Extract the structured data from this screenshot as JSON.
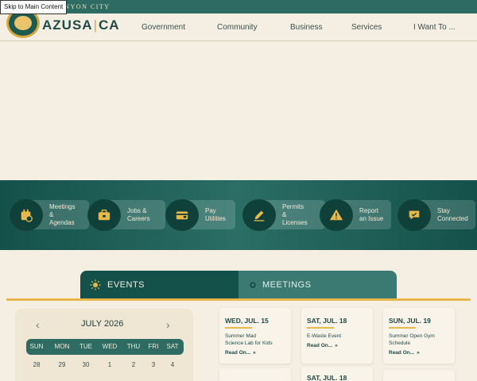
{
  "skip_link": "Skip to Main Content",
  "header": {
    "tagline": "ANYON CITY",
    "logo_left": "AZUSA",
    "logo_sep": "|",
    "logo_right": "CA",
    "nav": [
      "Government",
      "Community",
      "Business",
      "Services",
      "I Want To ..."
    ]
  },
  "quick_links": [
    {
      "label": "Meetings\n&\nAgendas",
      "icon": "meetings-icon"
    },
    {
      "label": "Jobs &\nCareers",
      "icon": "briefcase-icon"
    },
    {
      "label": "Pay\nUtilities",
      "icon": "wallet-icon"
    },
    {
      "label": "Permits\n&\nLicenses",
      "icon": "pencil-icon"
    },
    {
      "label": "Report\nan Issue",
      "icon": "warning-icon"
    },
    {
      "label": "Stay\nConnected",
      "icon": "chat-icon"
    }
  ],
  "tabs": {
    "events": "EVENTS",
    "meetings": "MEETINGS"
  },
  "calendar": {
    "prev": "‹",
    "next": "›",
    "month": "JULY 2026",
    "weekdays": [
      "SUN",
      "MON",
      "TUE",
      "WED",
      "THU",
      "FRI",
      "SAT"
    ],
    "first_row": [
      "28",
      "29",
      "30",
      "1",
      "2",
      "3",
      "4"
    ]
  },
  "events": [
    {
      "date": "WED, JUL. 15",
      "title": "Summer Mad\nScience Lab for Kids",
      "more": "Read On..."
    },
    {
      "date": "SAT, JUL. 18",
      "title": "E-Waste Event",
      "more": "Read On..."
    },
    {
      "date": "SUN, JUL. 19",
      "title": "Summer Open Gym\nSchedule",
      "more": "Read On..."
    },
    {
      "date": "SAT, JUL. 18"
    }
  ],
  "colors": {
    "primary": "#14514a",
    "accent": "#e8b84a",
    "background": "#f5efe3"
  }
}
